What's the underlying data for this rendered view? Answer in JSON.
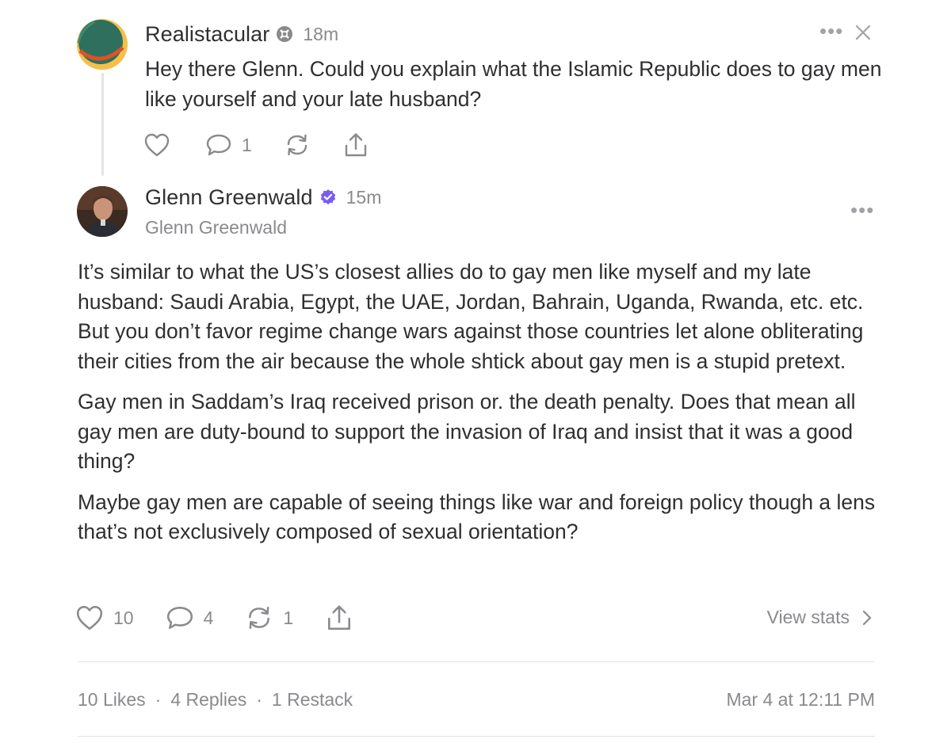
{
  "reply": {
    "author": "Realistacular",
    "time": "18m",
    "text": "Hey there Glenn. Could you explain what the Islamic Republic does to gay men like yourself and your late husband?",
    "comment_count": "1",
    "more_icon": "ellipsis-icon",
    "close_icon": "close-icon"
  },
  "post": {
    "author": "Glenn Greenwald",
    "time": "15m",
    "handle": "Glenn Greenwald",
    "verified_color": "#7b5cf0",
    "paragraphs": [
      "It’s similar to what the US’s closest allies do to gay men like myself and my late husband: Saudi Arabia, Egypt, the UAE, Jordan, Bahrain, Uganda, Rwanda, etc. etc. But you don’t favor regime change wars against those countries let alone obliterating their cities from the air because the whole shtick about gay men is a stupid pretext.",
      "Gay men in Saddam’s Iraq received prison or. the death penalty. Does that mean all gay men are duty-bound to support the invasion of Iraq and insist that it was a good thing?",
      "Maybe gay men are capable of seeing things like war and foreign policy though a lens that’s not exclusively composed of sexual orientation?"
    ],
    "likes": "10",
    "comments": "4",
    "restacks": "1",
    "view_stats": "View stats"
  },
  "footer": {
    "likes": "10 Likes",
    "replies": "4 Replies",
    "restacks": "1 Restack",
    "separator": "·",
    "timestamp": "Mar 4 at 12:11 PM"
  }
}
